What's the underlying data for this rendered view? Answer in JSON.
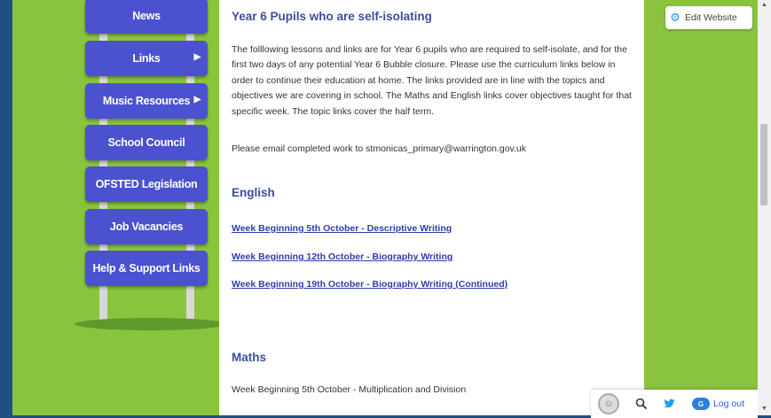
{
  "nav": {
    "items": [
      {
        "label": "News",
        "has_submenu": false
      },
      {
        "label": "Links",
        "has_submenu": true
      },
      {
        "label": "Music Resources",
        "has_submenu": true
      },
      {
        "label": "School Council",
        "has_submenu": false
      },
      {
        "label": "OFSTED Legislation",
        "has_submenu": false
      },
      {
        "label": "Job Vacancies",
        "has_submenu": false
      },
      {
        "label": "Help & Support Links",
        "has_submenu": false
      }
    ]
  },
  "content": {
    "title": "Year 6 Pupils who are self-isolating",
    "intro": "The folllowing lessons and links are for Year 6 pupils who are required to self-isolate, and for the first two days of any potential Year 6 Bubble closure. Please use the curriculum links below in order to continue their education at home. The links provided are in line with the topics and objectives we are covering in school. The Maths and English links cover objectives taught for that specific week. The topic links cover the half term.",
    "email_note": "Please email completed work to stmonicas_primary@warrington.gov.uk",
    "english_heading": "English",
    "english_links": [
      "Week Beginning 5th October - Descriptive Writing",
      "Week Beginning 12th October - Biography Writing",
      "Week Beginning 19th October - Biography Writing (Continued)"
    ],
    "maths_heading": "Maths",
    "maths_item": "Week Beginning 5th October - Multiplication and Division"
  },
  "admin": {
    "edit_label": "Edit Website",
    "logout_label": "Log out",
    "logo_text": "G"
  },
  "icons": {
    "gear": "gear-icon",
    "search": "search-icon",
    "twitter": "twitter-icon",
    "avatar": "avatar-icon"
  },
  "colors": {
    "nav_button": "#4a52cf",
    "page_green": "#8ac43f",
    "heading_blue": "#3c4ea0",
    "link_blue": "#2f3ea8"
  }
}
